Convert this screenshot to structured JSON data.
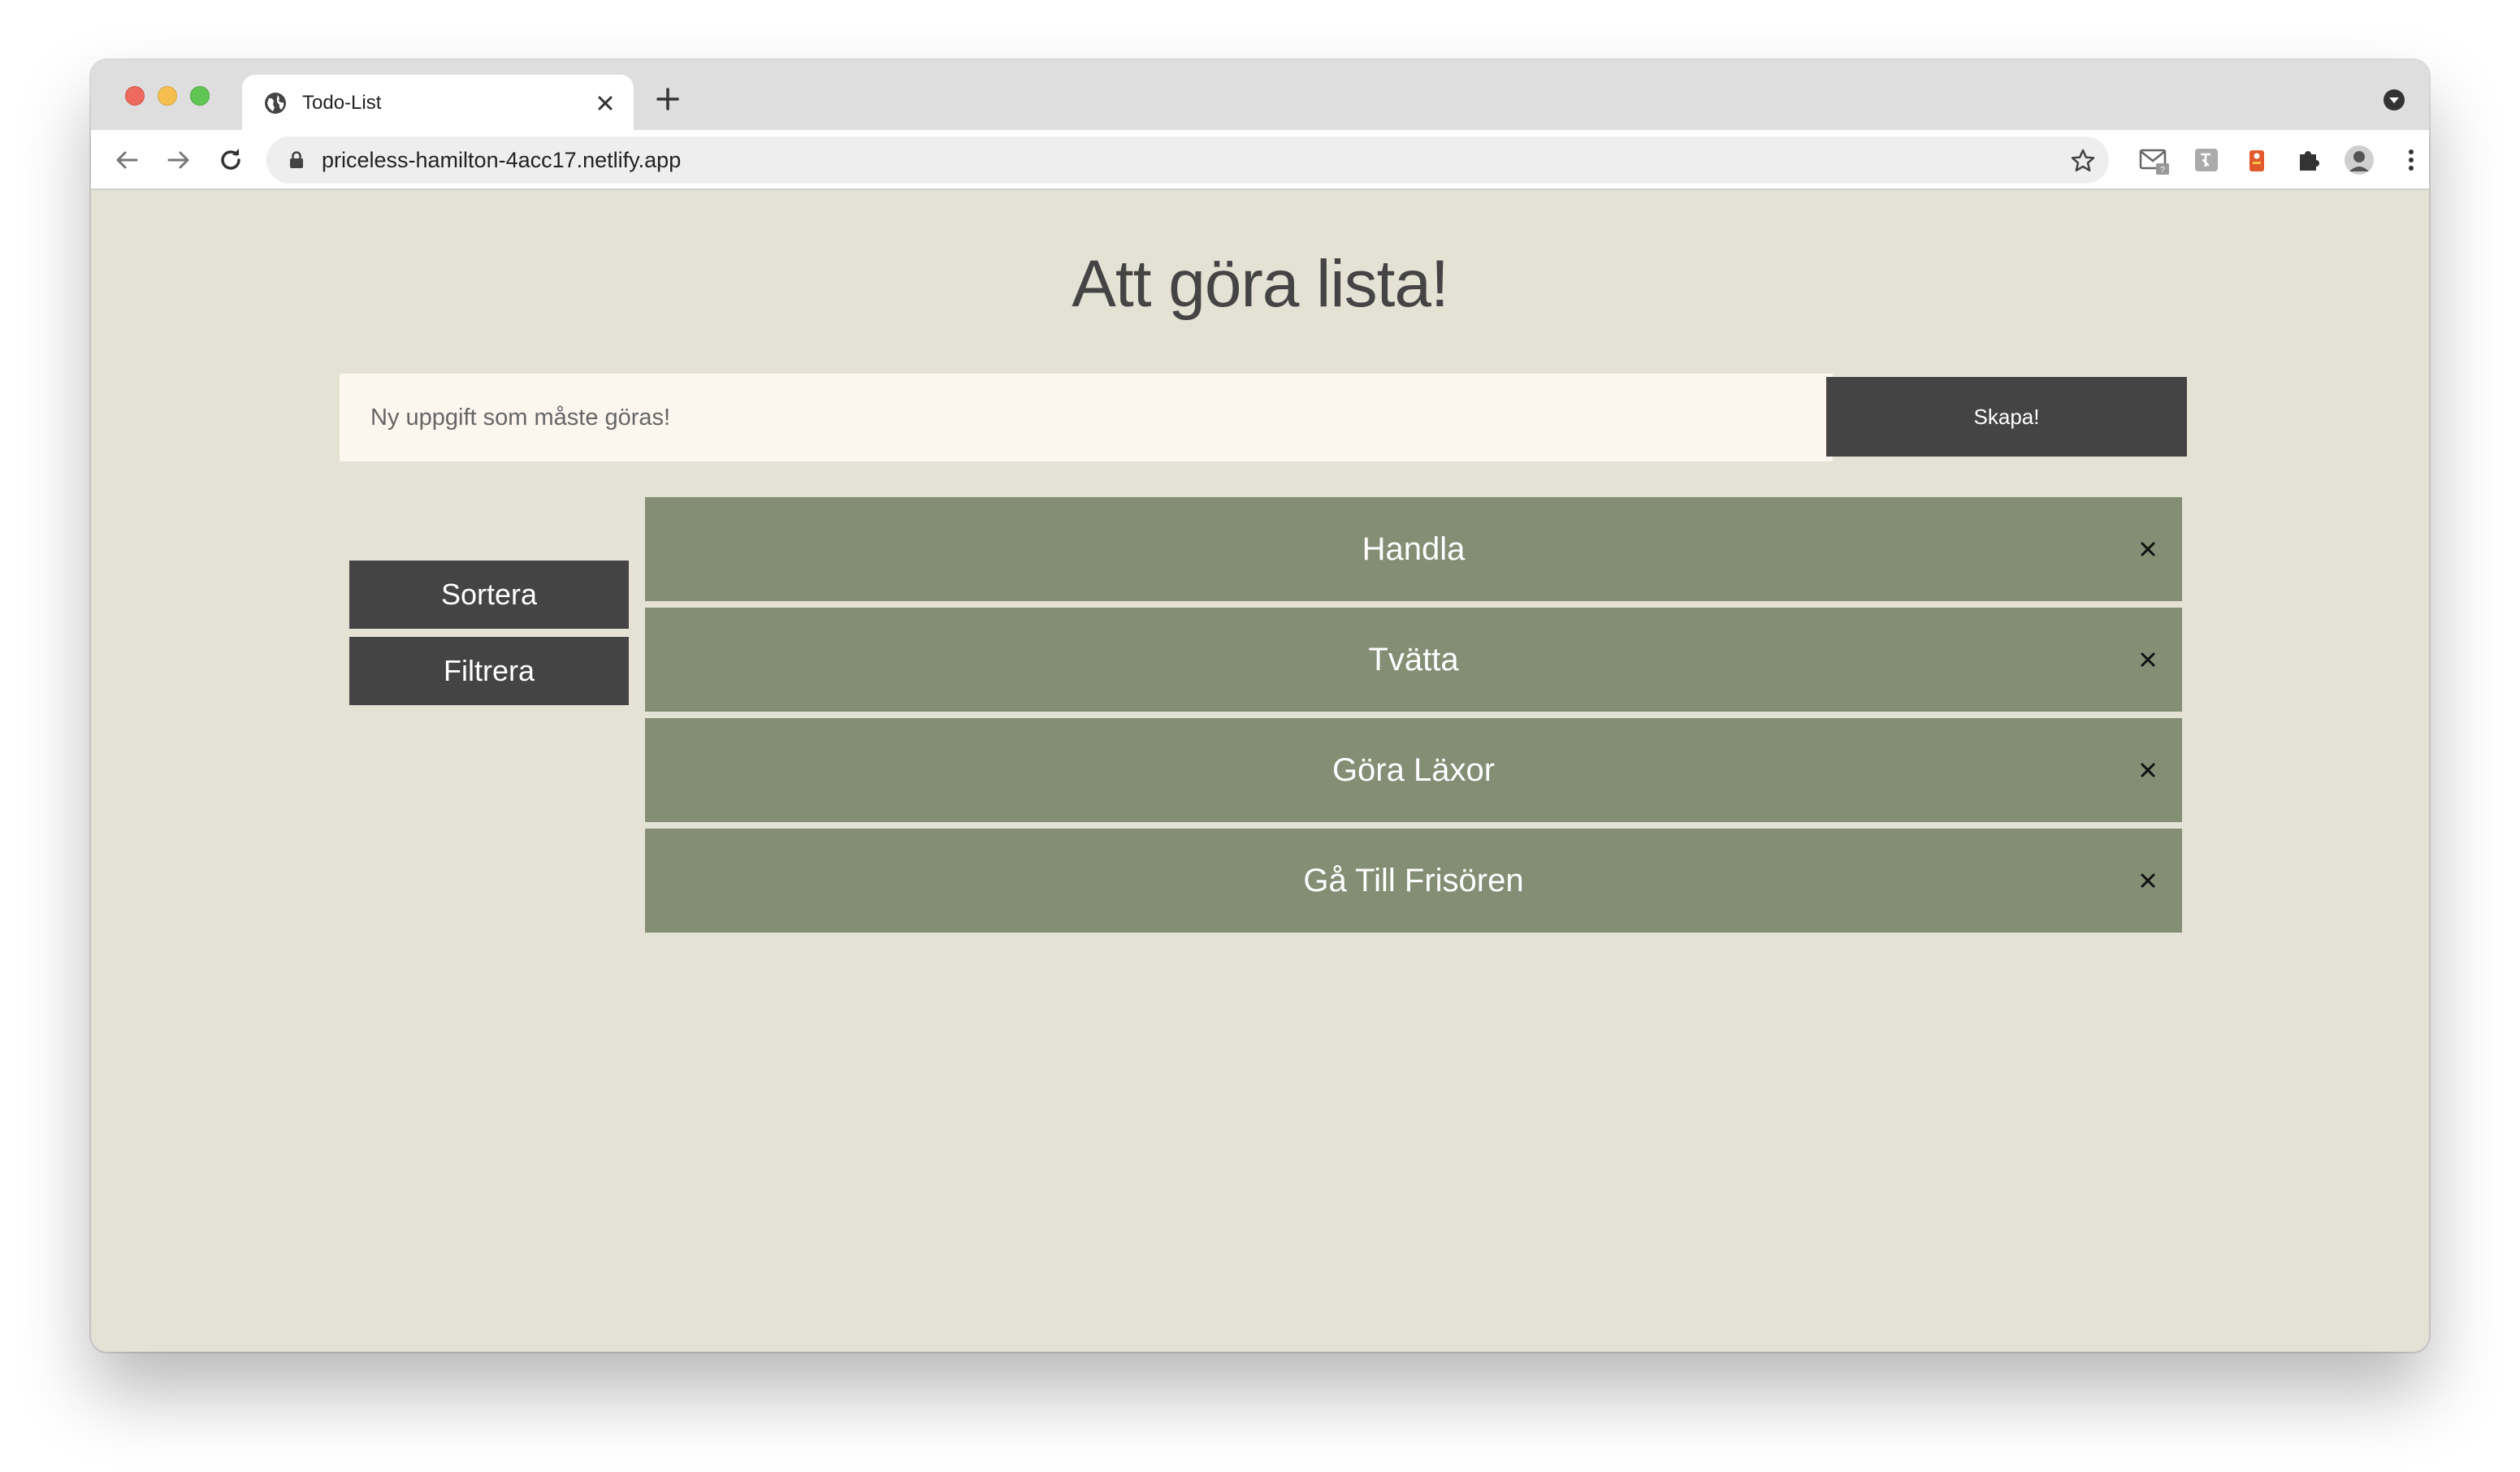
{
  "browser": {
    "tab_title": "Todo-List",
    "url": "priceless-hamilton-4acc17.netlify.app"
  },
  "page": {
    "heading": "Att göra lista!",
    "new_task": {
      "placeholder": "Ny uppgift som måste göras!",
      "value": ""
    },
    "create_label": "Skapa!",
    "sort_label": "Sortera",
    "filter_label": "Filtrera",
    "todos": [
      {
        "text": "Handla"
      },
      {
        "text": "Tvätta"
      },
      {
        "text": "Göra Läxor"
      },
      {
        "text": "Gå Till Frisören"
      }
    ]
  },
  "colors": {
    "page_background": "#e4e2d5",
    "dark_button": "#444444",
    "todo_item": "#838e74",
    "input_background": "#fcf6ee"
  }
}
